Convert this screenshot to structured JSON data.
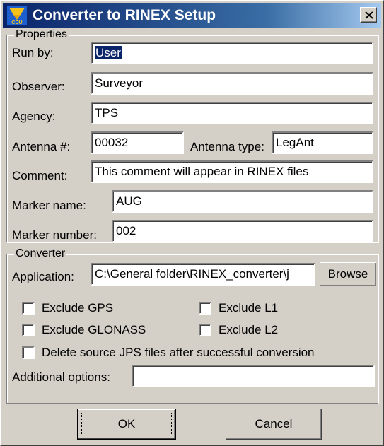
{
  "window": {
    "title": "Converter to RINEX Setup",
    "icon_label": "CDU",
    "close_icon": "close-x"
  },
  "properties": {
    "group_label": "Properties",
    "run_by": {
      "label": "Run by:",
      "value": "User"
    },
    "observer": {
      "label": "Observer:",
      "value": "Surveyor"
    },
    "agency": {
      "label": "Agency:",
      "value": "TPS"
    },
    "antenna_number": {
      "label": "Antenna #:",
      "value": "00032"
    },
    "antenna_type": {
      "label": "Antenna type:",
      "value": "LegAnt"
    },
    "comment": {
      "label": "Comment:",
      "value": "This comment will appear in RINEX files"
    },
    "marker_name": {
      "label": "Marker name:",
      "value": "AUG"
    },
    "marker_number": {
      "label": "Marker number:",
      "value": "002"
    }
  },
  "converter": {
    "group_label": "Converter",
    "application": {
      "label": "Application:",
      "value": "C:\\General folder\\RINEX_converter\\j"
    },
    "browse_label": "Browse",
    "exclude_gps": {
      "label": "Exclude GPS",
      "checked": false
    },
    "exclude_glonass": {
      "label": "Exclude GLONASS",
      "checked": false
    },
    "exclude_l1": {
      "label": "Exclude L1",
      "checked": false
    },
    "exclude_l2": {
      "label": "Exclude L2",
      "checked": false
    },
    "delete_source": {
      "label": "Delete source JPS files after successful conversion",
      "checked": false
    },
    "additional_options": {
      "label": "Additional options:",
      "value": ""
    }
  },
  "buttons": {
    "ok_label": "OK",
    "cancel_label": "Cancel"
  },
  "colors": {
    "title_bar_start": "#0a246a",
    "title_bar_end": "#a6caf0",
    "dialog_face": "#d4d0c8",
    "selection": "#0a246a"
  }
}
